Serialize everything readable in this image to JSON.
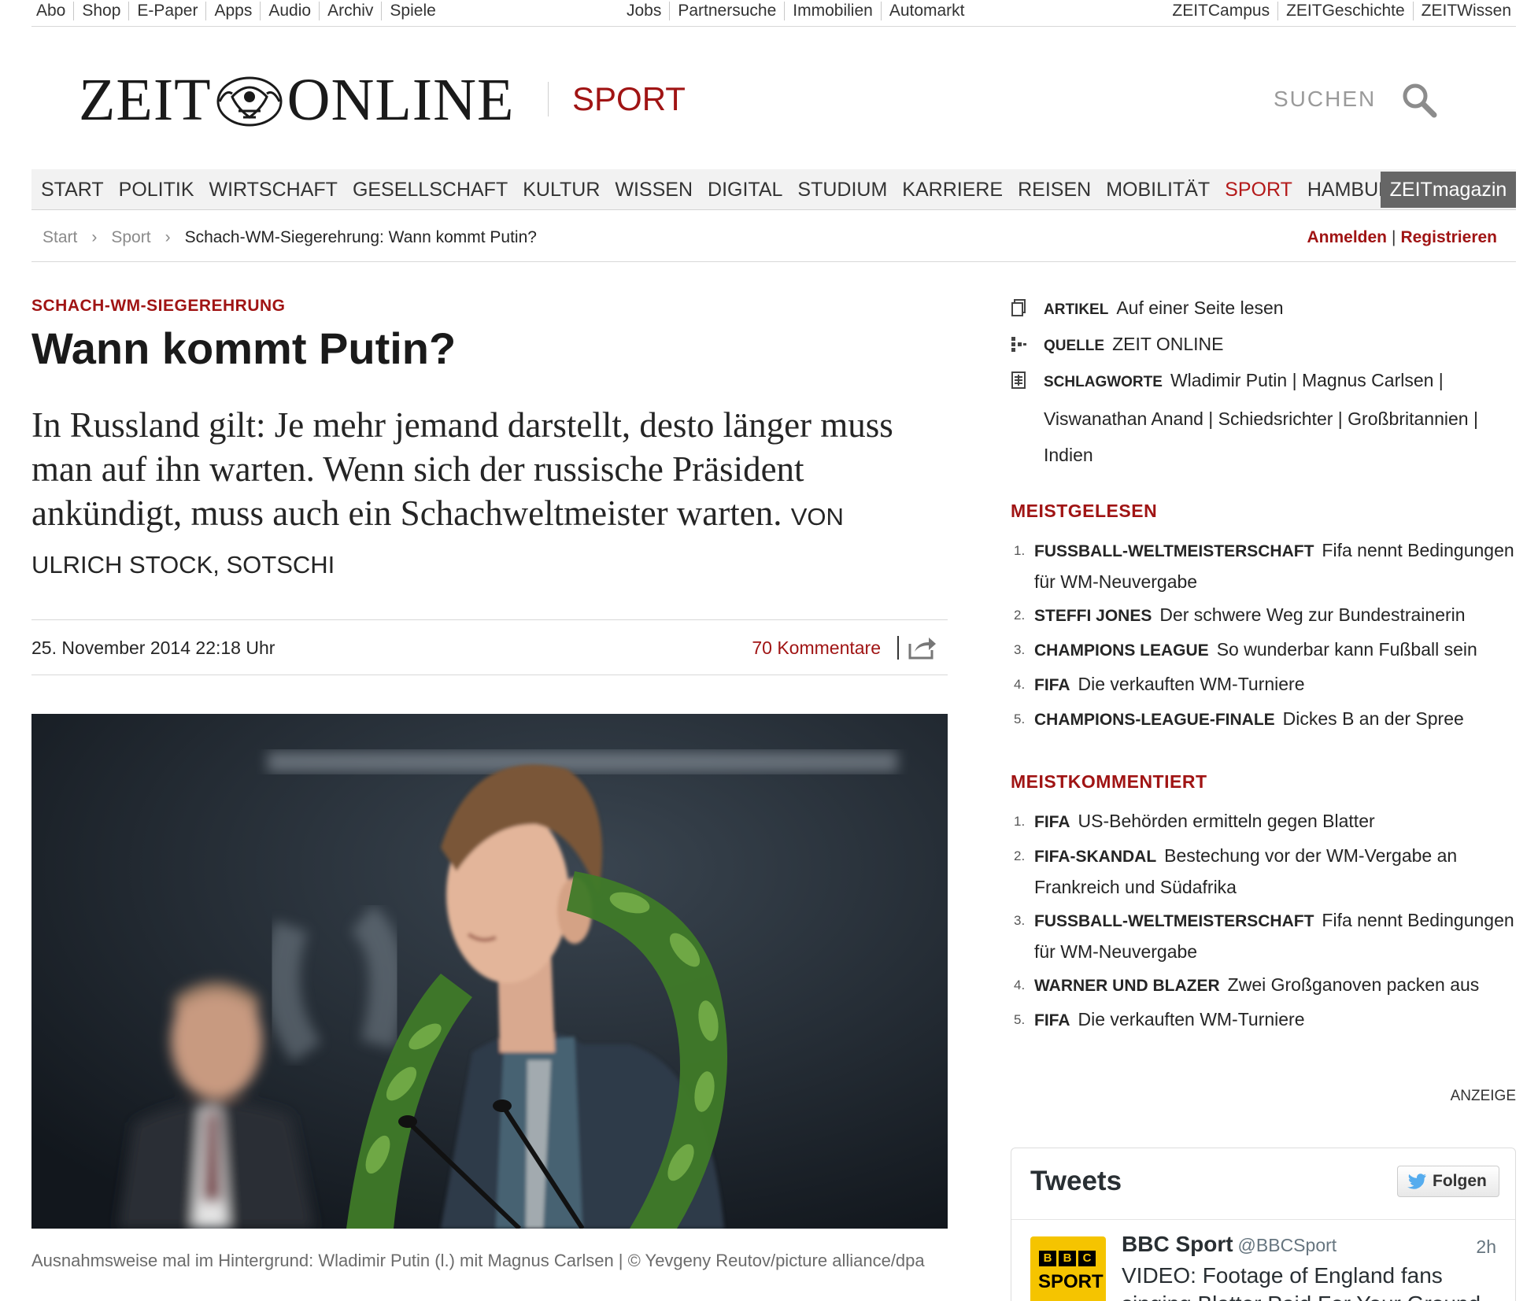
{
  "top_nav": {
    "left": [
      "Abo",
      "Shop",
      "E-Paper",
      "Apps",
      "Audio",
      "Archiv",
      "Spiele"
    ],
    "center": [
      "Jobs",
      "Partnersuche",
      "Immobilien",
      "Automarkt"
    ],
    "right": [
      "ZEITCampus",
      "ZEITGeschichte",
      "ZEITWissen"
    ]
  },
  "header": {
    "logo_left": "ZEIT",
    "logo_right": "ONLINE",
    "ressort": "SPORT",
    "search_label": "SUCHEN"
  },
  "main_nav": {
    "items": [
      "START",
      "POLITIK",
      "WIRTSCHAFT",
      "GESELLSCHAFT",
      "KULTUR",
      "WISSEN",
      "DIGITAL",
      "STUDIUM",
      "KARRIERE",
      "REISEN",
      "MOBILITÄT",
      "SPORT",
      "HAMBURG"
    ],
    "active": "SPORT",
    "magazin": "ZEITmagazin"
  },
  "breadcrumb": {
    "items": [
      "Start",
      "Sport",
      "Schach-WM-Siegerehrung: Wann kommt Putin?"
    ],
    "separator": "›"
  },
  "account": {
    "login": "Anmelden",
    "separator": "|",
    "register": "Registrieren"
  },
  "article": {
    "kicker": "SCHACH-WM-SIEGEREHRUNG",
    "headline": "Wann kommt Putin?",
    "teaser": "In Russland gilt: Je mehr jemand darstellt, desto länger muss man auf ihn warten. Wenn sich der russische Präsident ankündigt, muss auch ein Schachweltmeister warten.",
    "author": "VON ULRICH STOCK, SOTSCHI",
    "date": "25. November 2014  22:18 Uhr",
    "comments": "70 Kommentare",
    "caption": "Ausnahmsweise mal im Hintergrund: Wladimir Putin (l.) mit Magnus Carlsen  |  © Yevgeny Reutov/picture alliance/dpa"
  },
  "sidebar": {
    "meta": [
      {
        "label": "ARTIKEL",
        "value": "Auf einer Seite lesen"
      },
      {
        "label": "QUELLE",
        "value": "ZEIT ONLINE"
      },
      {
        "label": "SCHLAGWORTE",
        "value": "Wladimir Putin | Magnus Carlsen | Viswanathan Anand | Schiedsrichter | Großbritannien | Indien"
      }
    ],
    "meistgelesen_title": "MEISTGELESEN",
    "meistgelesen": [
      {
        "num": "1.",
        "kicker": "FUSSBALL-WELTMEISTERSCHAFT",
        "title": "Fifa nennt Bedingungen für WM-Neuvergabe"
      },
      {
        "num": "2.",
        "kicker": "STEFFI JONES",
        "title": "Der schwere Weg zur Bundestrainerin"
      },
      {
        "num": "3.",
        "kicker": "CHAMPIONS LEAGUE",
        "title": "So wunderbar kann Fußball sein"
      },
      {
        "num": "4.",
        "kicker": "FIFA",
        "title": "Die verkauften WM-Turniere"
      },
      {
        "num": "5.",
        "kicker": "CHAMPIONS-LEAGUE-FINALE",
        "title": "Dickes B an der Spree"
      }
    ],
    "meistkommentiert_title": "MEISTKOMMENTIERT",
    "meistkommentiert": [
      {
        "num": "1.",
        "kicker": "FIFA",
        "title": "US-Behörden ermitteln gegen Blatter"
      },
      {
        "num": "2.",
        "kicker": "FIFA-SKANDAL",
        "title": "Bestechung vor der WM-Vergabe an Frankreich und Südafrika"
      },
      {
        "num": "3.",
        "kicker": "FUSSBALL-WELTMEISTERSCHAFT",
        "title": "Fifa nennt Bedingungen für WM-Neuvergabe"
      },
      {
        "num": "4.",
        "kicker": "WARNER UND BLAZER",
        "title": "Zwei Großganoven packen aus"
      },
      {
        "num": "5.",
        "kicker": "FIFA",
        "title": "Die verkauften WM-Turniere"
      }
    ],
    "ad_label": "ANZEIGE",
    "tweets": {
      "title": "Tweets",
      "follow": "Folgen",
      "avatar_bbc": [
        "B",
        "B",
        "C"
      ],
      "avatar_sport": "SPORT",
      "name": "BBC Sport",
      "handle": "@BBCSport",
      "time": "2h",
      "text": "VIDEO: Footage of England fans singing Blatter Paid For Your Ground"
    }
  },
  "colors": {
    "accent": "#a01414",
    "nav_bg": "#f2f2f2",
    "magazin_bg": "#666666",
    "twitter_blue": "#55acee",
    "bbc_yellow": "#f5c400"
  }
}
